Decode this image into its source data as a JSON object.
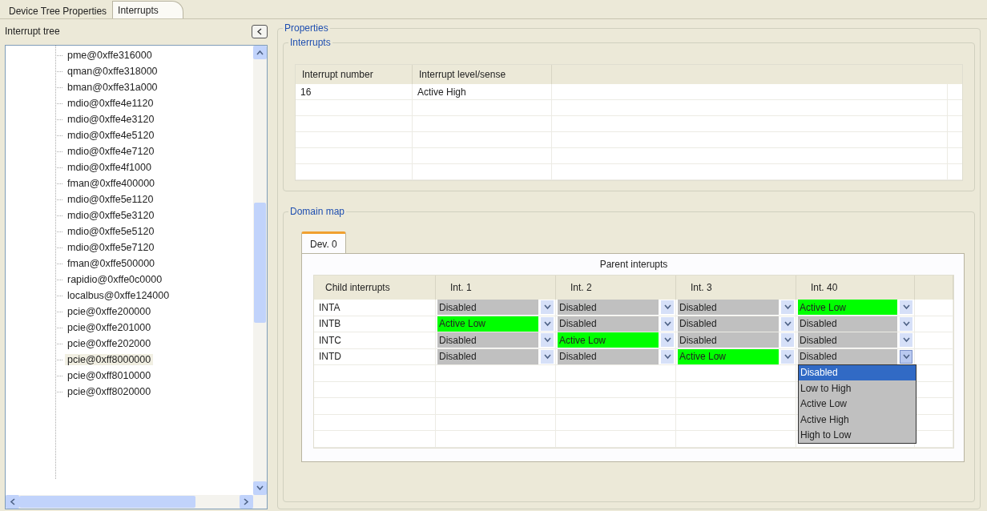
{
  "tabs": [
    {
      "label": "Device Tree Properties",
      "selected": false
    },
    {
      "label": "Interrupts",
      "selected": true
    }
  ],
  "tree": {
    "title": "Interrupt tree",
    "items": [
      {
        "label": "pme@0xffe316000",
        "selected": false
      },
      {
        "label": "qman@0xffe318000",
        "selected": false
      },
      {
        "label": "bman@0xffe31a000",
        "selected": false
      },
      {
        "label": "mdio@0xffe4e1120",
        "selected": false
      },
      {
        "label": "mdio@0xffe4e3120",
        "selected": false
      },
      {
        "label": "mdio@0xffe4e5120",
        "selected": false
      },
      {
        "label": "mdio@0xffe4e7120",
        "selected": false
      },
      {
        "label": "mdio@0xffe4f1000",
        "selected": false
      },
      {
        "label": "fman@0xffe400000",
        "selected": false
      },
      {
        "label": "mdio@0xffe5e1120",
        "selected": false
      },
      {
        "label": "mdio@0xffe5e3120",
        "selected": false
      },
      {
        "label": "mdio@0xffe5e5120",
        "selected": false
      },
      {
        "label": "mdio@0xffe5e7120",
        "selected": false
      },
      {
        "label": "fman@0xffe500000",
        "selected": false
      },
      {
        "label": "rapidio@0xffe0c0000",
        "selected": false
      },
      {
        "label": "localbus@0xffe124000",
        "selected": false
      },
      {
        "label": "pcie@0xffe200000",
        "selected": false
      },
      {
        "label": "pcie@0xffe201000",
        "selected": false
      },
      {
        "label": "pcie@0xffe202000",
        "selected": false
      },
      {
        "label": "pcie@0xff8000000",
        "selected": true
      },
      {
        "label": "pcie@0xff8010000",
        "selected": false
      },
      {
        "label": "pcie@0xff8020000",
        "selected": false
      }
    ]
  },
  "properties": {
    "title": "Properties",
    "interrupts": {
      "title": "Interrupts",
      "columns": [
        "Interrupt number",
        "Interrupt level/sense"
      ],
      "rows": [
        [
          "16",
          "Active High"
        ]
      ]
    },
    "domain_map": {
      "title": "Domain map",
      "tabs": [
        {
          "label": "Dev. 0",
          "selected": true
        }
      ],
      "parent_heading": "Parent interupts",
      "columns": [
        "Child interrupts",
        "Int. 1",
        "Int. 2",
        "Int. 3",
        "Int. 40"
      ],
      "rows": [
        {
          "cells": [
            {
              "kind": "text",
              "value": "INTA"
            },
            {
              "kind": "combo",
              "value": "Disabled",
              "color": "#c0c0c0",
              "open": false
            },
            {
              "kind": "combo",
              "value": "Disabled",
              "color": "#c0c0c0",
              "open": false
            },
            {
              "kind": "combo",
              "value": "Disabled",
              "color": "#c0c0c0",
              "open": false
            },
            {
              "kind": "combo",
              "value": "Active Low",
              "color": "#00ff00",
              "open": false
            }
          ]
        },
        {
          "cells": [
            {
              "kind": "text",
              "value": "INTB"
            },
            {
              "kind": "combo",
              "value": "Active Low",
              "color": "#00ff00",
              "open": false
            },
            {
              "kind": "combo",
              "value": "Disabled",
              "color": "#c0c0c0",
              "open": false
            },
            {
              "kind": "combo",
              "value": "Disabled",
              "color": "#c0c0c0",
              "open": false
            },
            {
              "kind": "combo",
              "value": "Disabled",
              "color": "#c0c0c0",
              "open": false
            }
          ]
        },
        {
          "cells": [
            {
              "kind": "text",
              "value": "INTC"
            },
            {
              "kind": "combo",
              "value": "Disabled",
              "color": "#c0c0c0",
              "open": false
            },
            {
              "kind": "combo",
              "value": "Active Low",
              "color": "#00ff00",
              "open": false
            },
            {
              "kind": "combo",
              "value": "Disabled",
              "color": "#c0c0c0",
              "open": false
            },
            {
              "kind": "combo",
              "value": "Disabled",
              "color": "#c0c0c0",
              "open": false
            }
          ]
        },
        {
          "cells": [
            {
              "kind": "text",
              "value": "INTD"
            },
            {
              "kind": "combo",
              "value": "Disabled",
              "color": "#c0c0c0",
              "open": false
            },
            {
              "kind": "combo",
              "value": "Disabled",
              "color": "#c0c0c0",
              "open": false
            },
            {
              "kind": "combo",
              "value": "Active Low",
              "color": "#00ff00",
              "open": false
            },
            {
              "kind": "combo",
              "value": "Disabled",
              "color": "#c0c0c0",
              "open": true
            }
          ]
        }
      ],
      "options": [
        {
          "label": "Disabled",
          "selected": true
        },
        {
          "label": "Low to High",
          "selected": false
        },
        {
          "label": "Active Low",
          "selected": false
        },
        {
          "label": "Active High",
          "selected": false
        },
        {
          "label": "High to Low",
          "selected": false
        }
      ]
    }
  }
}
